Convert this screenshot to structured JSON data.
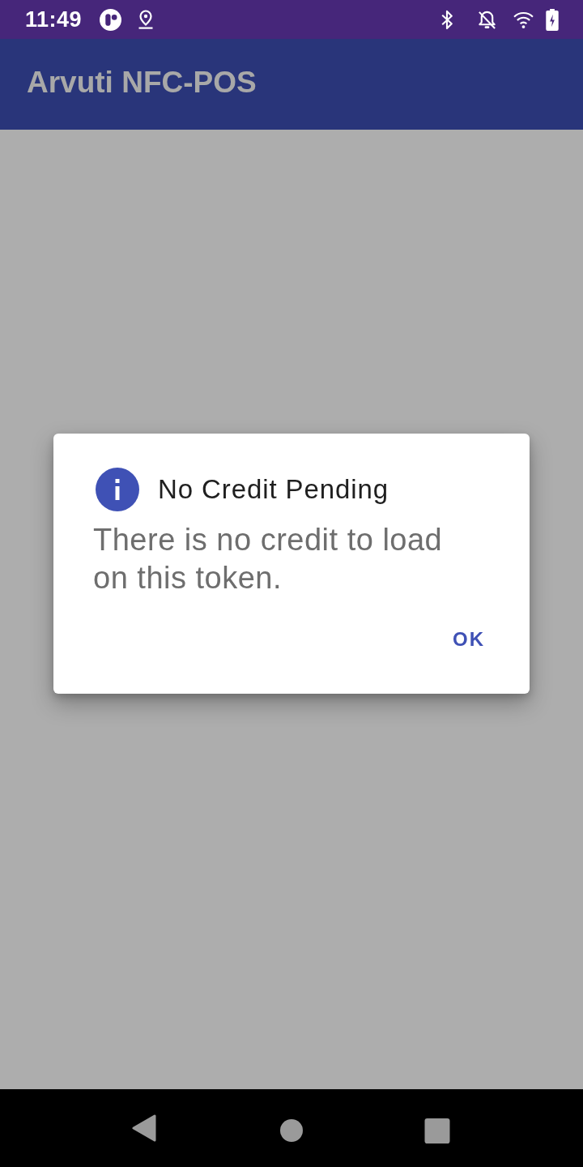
{
  "status_bar": {
    "time": "11:49"
  },
  "app_bar": {
    "title": "Arvuti NFC-POS"
  },
  "dialog": {
    "title": "No Credit Pending",
    "message": "There is no credit to load on this token.",
    "buttons": [
      "OK"
    ]
  }
}
